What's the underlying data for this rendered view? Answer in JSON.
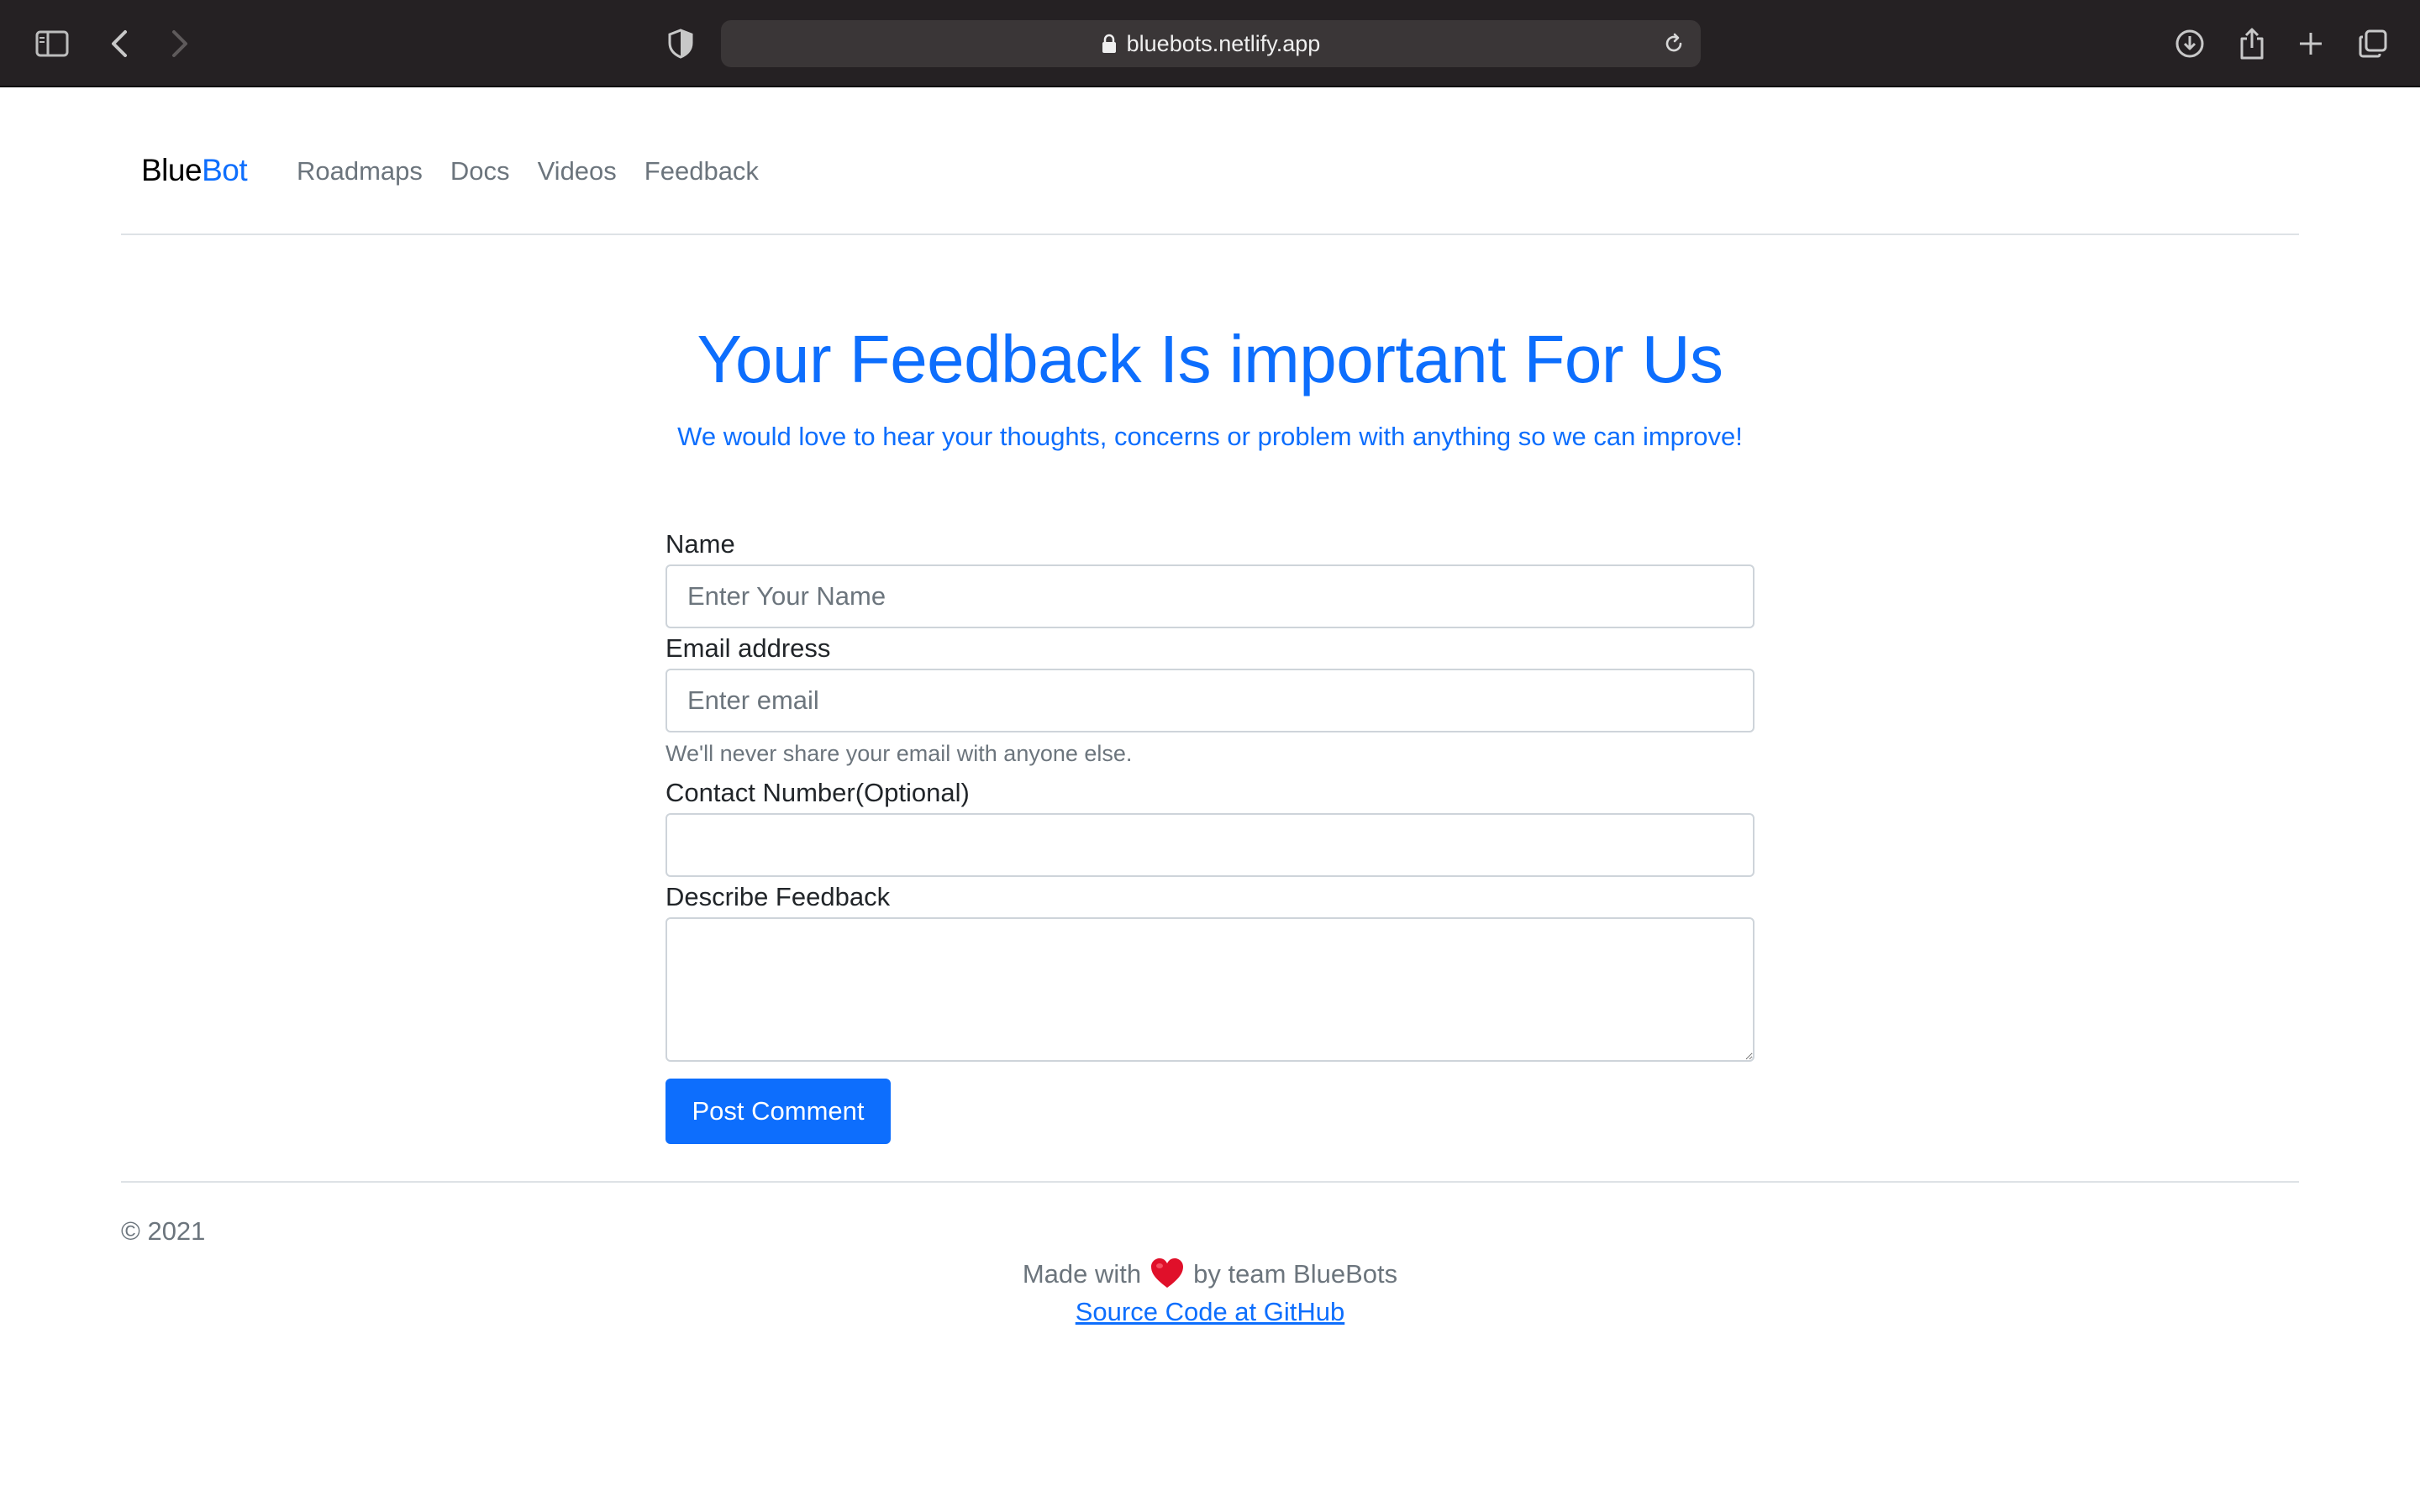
{
  "browser": {
    "url": "bluebots.netlify.app",
    "icons": [
      "sidebar-icon",
      "back-icon",
      "forward-icon",
      "shield-icon",
      "lock-icon",
      "reload-icon",
      "download-icon",
      "share-icon",
      "new-tab-icon",
      "tabs-overview-icon"
    ]
  },
  "navbar": {
    "brand_part1": "Blue",
    "brand_part2": "Bot",
    "links": [
      {
        "label": "Roadmaps"
      },
      {
        "label": "Docs"
      },
      {
        "label": "Videos"
      },
      {
        "label": "Feedback"
      }
    ]
  },
  "hero": {
    "title": "Your Feedback Is important For Us",
    "subtitle": "We would love to hear your thoughts, concerns or problem with anything so we can improve!"
  },
  "form": {
    "name_label": "Name",
    "name_placeholder": "Enter Your Name",
    "email_label": "Email address",
    "email_placeholder": "Enter email",
    "email_help": "We'll never share your email with anyone else.",
    "contact_label": "Contact Number(Optional)",
    "feedback_label": "Describe Feedback",
    "submit_label": "Post Comment"
  },
  "footer": {
    "copyright": "© 2021",
    "made_prefix": "Made with",
    "made_suffix": "by team BlueBots",
    "source_link": "Source Code at GitHub"
  },
  "colors": {
    "accent": "#0d6efd",
    "chrome_bg": "#252123",
    "muted_text": "#6c757d",
    "heart": "#e0102a"
  }
}
